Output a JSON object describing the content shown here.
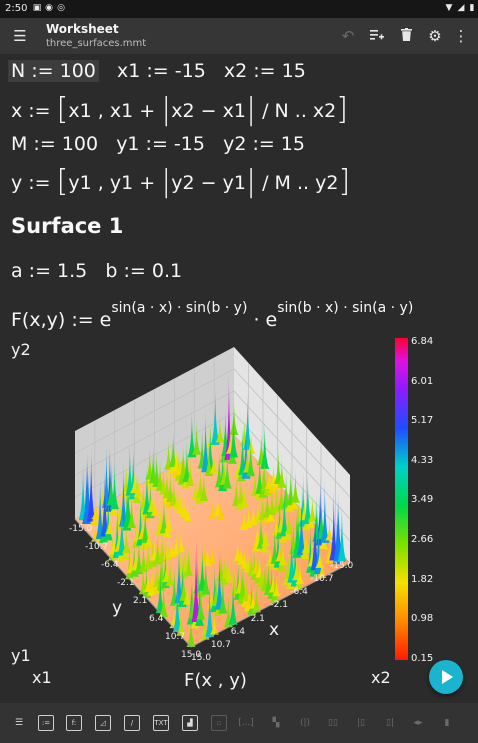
{
  "status_bar": {
    "time": "2:50"
  },
  "app_bar": {
    "title": "Worksheet",
    "subtitle": "three_surfaces.mmt",
    "icons": [
      "menu-icon",
      "undo-icon",
      "add-to-list-icon",
      "delete-icon",
      "settings-icon",
      "more-vert-icon"
    ]
  },
  "worksheet": {
    "line1": {
      "n_def": "N := 100",
      "x1_def": "x1 := -15",
      "x2_def": "x2 := 15"
    },
    "line2": {
      "lhs": "x := ",
      "body": "x1 , x1 + ",
      "abs": "x2 − x1",
      "tail": " / N .. x2"
    },
    "line3": {
      "m_def": "M := 100",
      "y1_def": "y1 := -15",
      "y2_def": "y2 := 15"
    },
    "line4": {
      "lhs": "y := ",
      "body": "y1 , y1 + ",
      "abs": "y2 − y1",
      "tail": " / M .. y2"
    },
    "heading": "Surface 1",
    "line5": {
      "a_def": "a := 1.5",
      "b_def": "b := 0.1"
    },
    "line6": {
      "lhs": "F(x,y) := e",
      "exp1": "sin(a · x) · sin(b · y)",
      "mid": " · e",
      "exp2": "sin(b · x) · sin(a · y)"
    }
  },
  "plot": {
    "label_y2": "y2",
    "label_y1": "y1",
    "label_x1": "x1",
    "label_x2": "x2",
    "axis_y": "y",
    "axis_x": "x",
    "z_label": "F(x , y)",
    "y_ticks": [
      "-15.0",
      "-10.7",
      "-6.4",
      "-2.1",
      "2.1",
      "6.4",
      "10.7",
      "15.0"
    ],
    "x_ticks": [
      "-15.0",
      "-10.7",
      "-6.4",
      "-2.1",
      "2.1",
      "6.4",
      "10.7",
      "15.0"
    ],
    "colorbar_ticks": [
      "6.84",
      "6.01",
      "5.17",
      "4.33",
      "3.49",
      "2.66",
      "1.82",
      "0.98",
      "0.15"
    ]
  },
  "run_button": {
    "icon": "play-icon"
  },
  "toolbar": {
    "icons": [
      "list-icon",
      "equation-icon",
      "function-icon",
      "image-icon",
      "plot-icon",
      "text-icon",
      "chart-icon",
      "dim-icon",
      "bracket-icon",
      "dim-icon",
      "dim-icon",
      "dim-icon",
      "dim-icon",
      "dim-icon",
      "dim-icon",
      "dim-icon"
    ],
    "text_label": "TXT",
    "bracket_label": "[...]"
  }
}
